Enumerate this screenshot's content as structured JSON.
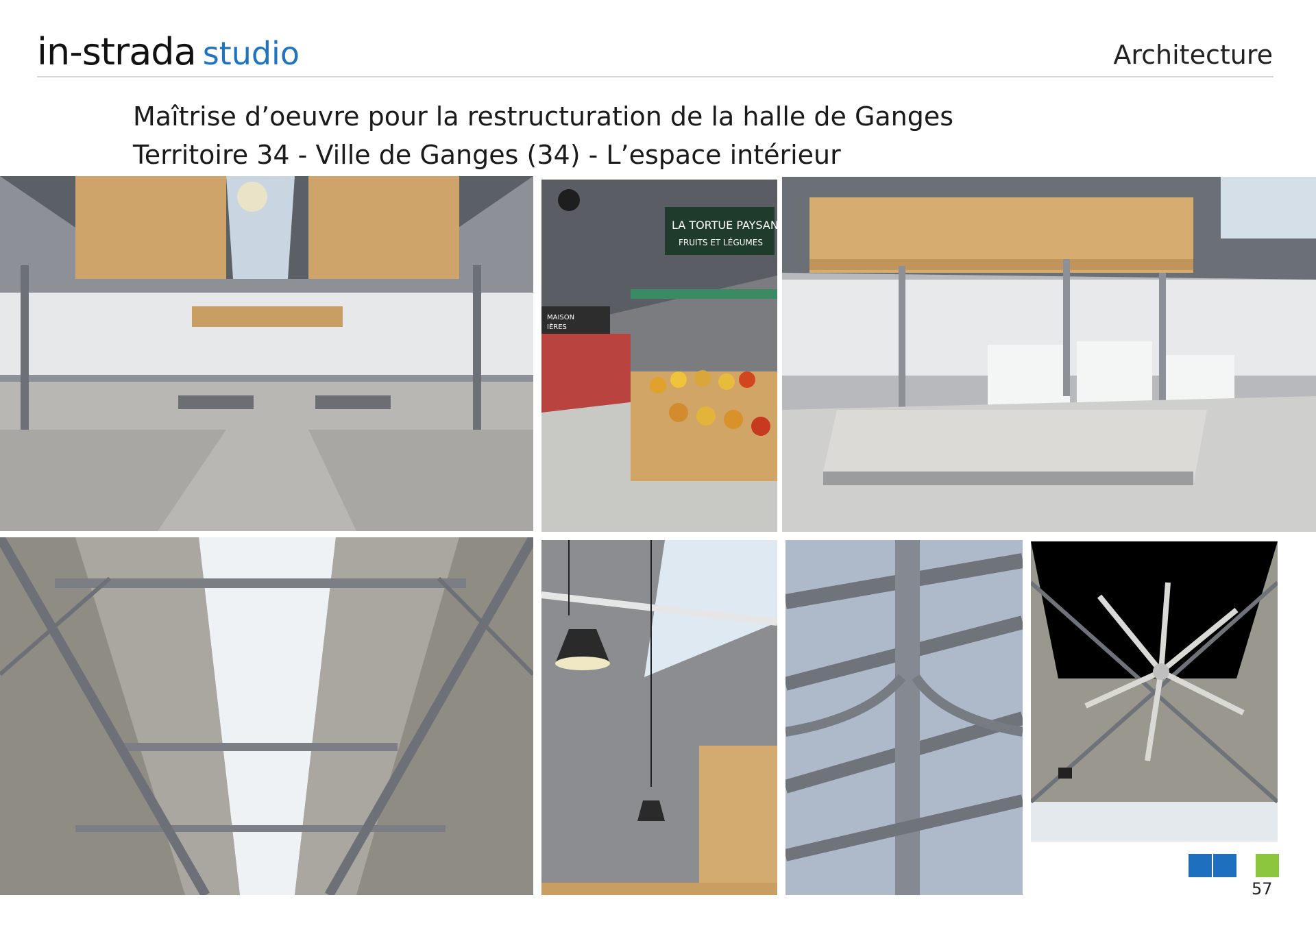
{
  "header": {
    "brand_main": "in-strada",
    "brand_sub": "studio",
    "section": "Architecture"
  },
  "title": {
    "line1": "Maîtrise d’oeuvre pour la restructuration de la halle de Ganges",
    "line2": "Territoire 34 - Ville de Ganges (34) - L’espace intérieur"
  },
  "photos": [
    {
      "name": "photo-hall-interior-stalls",
      "signs": []
    },
    {
      "name": "photo-market-stall-produce",
      "signs": [
        "LA TORTUE PAYSANE",
        "FRUITS ET LÉGUMES",
        "MAISON",
        "IÈRES"
      ]
    },
    {
      "name": "photo-wooden-stall-canopy",
      "signs": []
    },
    {
      "name": "photo-roof-skylight-trusses",
      "signs": []
    },
    {
      "name": "photo-pendant-lamps-canopy",
      "signs": []
    },
    {
      "name": "photo-glazed-roof-detail",
      "signs": []
    },
    {
      "name": "photo-ceiling-fan-roof",
      "signs": []
    }
  ],
  "colors": {
    "blue": "#1f6fbf",
    "green": "#8cc63f"
  },
  "footer": {
    "page_number": "57"
  }
}
